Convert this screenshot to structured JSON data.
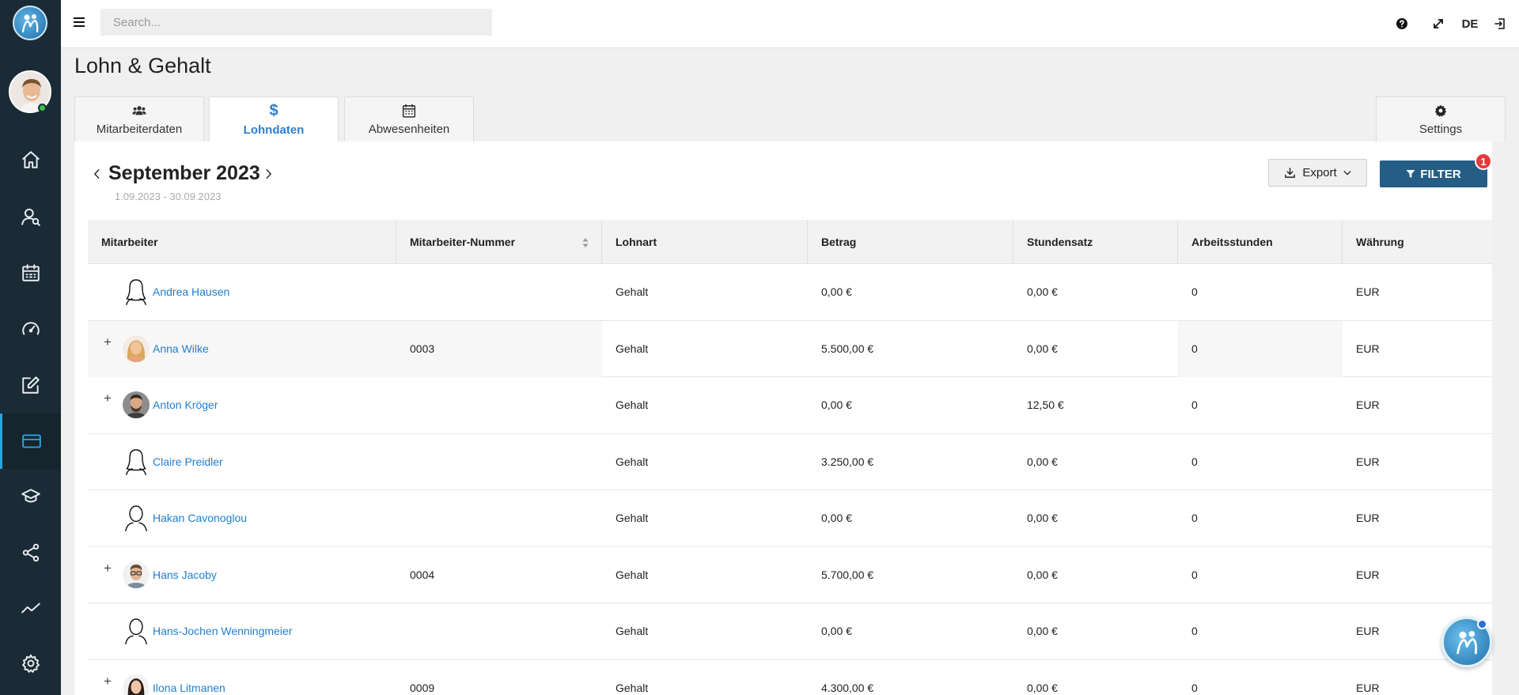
{
  "search": {
    "placeholder": "Search..."
  },
  "topbar": {
    "language": "DE"
  },
  "page": {
    "title": "Lohn & Gehalt"
  },
  "tabs": [
    {
      "label": "Mitarbeiterdaten",
      "icon": "users-icon"
    },
    {
      "label": "Lohndaten",
      "icon": "dollar-icon",
      "symbol": "$"
    },
    {
      "label": "Abwesenheiten",
      "icon": "calendar-icon"
    },
    {
      "label": "Settings",
      "icon": "gear-icon"
    }
  ],
  "period": {
    "title": "September 2023",
    "range": "1.09.2023 - 30.09.2023"
  },
  "toolbar": {
    "export_label": "Export",
    "filter_label": "FILTER",
    "filter_count": "1"
  },
  "table": {
    "columns": [
      "Mitarbeiter",
      "Mitarbeiter-Nummer",
      "Lohnart",
      "Betrag",
      "Stundensatz",
      "Arbeitsstunden",
      "Währung"
    ],
    "rows": [
      {
        "expandable": false,
        "avatar": "female-placeholder",
        "name": "Andrea Hausen",
        "number": "",
        "type": "Gehalt",
        "amount": "0,00 €",
        "rate": "0,00 €",
        "hours": "0",
        "currency": "EUR"
      },
      {
        "expandable": true,
        "avatar": "photo-female",
        "name": "Anna Wilke",
        "number": "0003",
        "type": "Gehalt",
        "amount": "5.500,00 €",
        "rate": "0,00 €",
        "hours": "0",
        "currency": "EUR"
      },
      {
        "expandable": true,
        "avatar": "photo-male-beard",
        "name": "Anton Kröger",
        "number": "",
        "type": "Gehalt",
        "amount": "0,00 €",
        "rate": "12,50 €",
        "hours": "0",
        "currency": "EUR"
      },
      {
        "expandable": false,
        "avatar": "female-placeholder",
        "name": "Claire Preidler",
        "number": "",
        "type": "Gehalt",
        "amount": "3.250,00 €",
        "rate": "0,00 €",
        "hours": "0",
        "currency": "EUR"
      },
      {
        "expandable": false,
        "avatar": "male-placeholder",
        "name": "Hakan Cavonoglou",
        "number": "",
        "type": "Gehalt",
        "amount": "0,00 €",
        "rate": "0,00 €",
        "hours": "0",
        "currency": "EUR"
      },
      {
        "expandable": true,
        "avatar": "photo-male-glasses",
        "name": "Hans Jacoby",
        "number": "0004",
        "type": "Gehalt",
        "amount": "5.700,00 €",
        "rate": "0,00 €",
        "hours": "0",
        "currency": "EUR"
      },
      {
        "expandable": false,
        "avatar": "male-placeholder",
        "name": "Hans-Jochen Wenningmeier",
        "number": "",
        "type": "Gehalt",
        "amount": "0,00 €",
        "rate": "0,00 €",
        "hours": "0",
        "currency": "EUR"
      },
      {
        "expandable": true,
        "avatar": "photo-female-dark",
        "name": "Ilona Litmanen",
        "number": "0009",
        "type": "Gehalt",
        "amount": "4.300,00 €",
        "rate": "0,00 €",
        "hours": "0",
        "currency": "EUR"
      }
    ]
  },
  "sidebar": {
    "items": [
      {
        "icon": "home-icon"
      },
      {
        "icon": "user-search-icon"
      },
      {
        "icon": "calendar-icon"
      },
      {
        "icon": "gauge-icon"
      },
      {
        "icon": "edit-icon"
      },
      {
        "icon": "credit-card-icon",
        "active": true
      },
      {
        "icon": "graduation-cap-icon"
      },
      {
        "icon": "share-icon"
      },
      {
        "icon": "trend-line-icon"
      },
      {
        "icon": "gear-icon"
      }
    ]
  },
  "colors": {
    "sidebar_bg": "#1b2b35",
    "accent": "#2aa3e0",
    "link": "#1f7fd1",
    "filter_button": "#245e85",
    "badge": "#e23b3b"
  }
}
